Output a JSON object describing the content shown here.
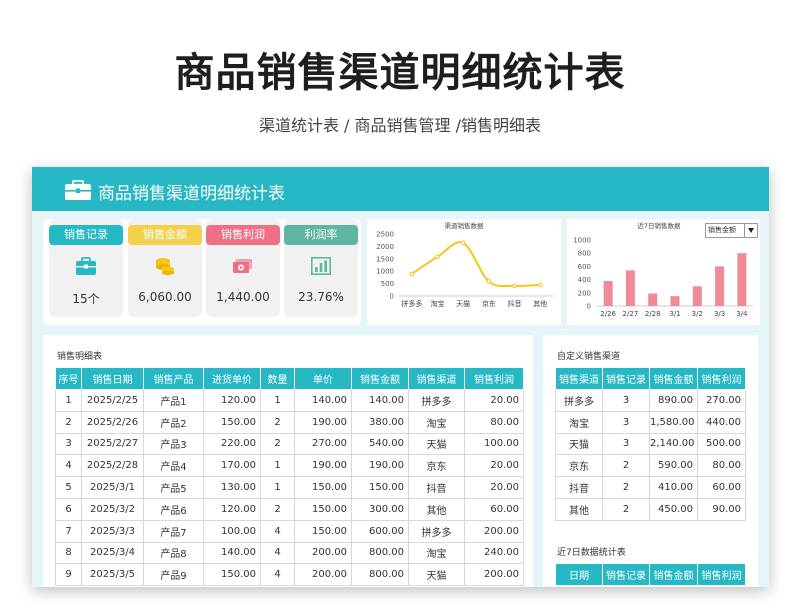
{
  "title": "商品销售渠道明细统计表",
  "subtitle": "渠道统计表 / 商品销售管理 /销售明细表",
  "header": {
    "title": "商品销售渠道明细统计表",
    "icon": "briefcase-icon"
  },
  "stats": [
    {
      "label": "销售记录",
      "value": "15个",
      "color": "#27b8c6",
      "icon": "briefcase-icon"
    },
    {
      "label": "销售金额",
      "value": "6,060.00",
      "color": "#f5d04d",
      "icon": "coins-icon"
    },
    {
      "label": "销售利润",
      "value": "1,440.00",
      "color": "#ef6f86",
      "icon": "money-icon"
    },
    {
      "label": "利润率",
      "value": "23.76%",
      "color": "#5fb6a0",
      "icon": "bar-chart-icon"
    }
  ],
  "chart_data": [
    {
      "type": "line",
      "title": "渠道销售数据",
      "categories": [
        "拼多多",
        "淘宝",
        "天猫",
        "京东",
        "抖音",
        "其他"
      ],
      "values": [
        890,
        1580,
        2140,
        590,
        410,
        450
      ],
      "ylim": [
        0,
        2500
      ],
      "yticks": [
        "0",
        "500",
        "1000",
        "1500",
        "2000",
        "2500"
      ],
      "color": "#f5c518"
    },
    {
      "type": "bar",
      "title": "近7日销售数据",
      "categories": [
        "2/26",
        "2/27",
        "2/28",
        "3/1",
        "3/2",
        "3/3",
        "3/4"
      ],
      "values": [
        380,
        540,
        190,
        150,
        300,
        600,
        800
      ],
      "ylim": [
        0,
        1000
      ],
      "yticks": [
        "0",
        "200",
        "400",
        "600",
        "800",
        "1000"
      ],
      "color": "#f08a97",
      "dropdown_value": "销售金额"
    }
  ],
  "detail_table": {
    "caption": "销售明细表",
    "headers": [
      "序号",
      "销售日期",
      "销售产品",
      "进货单价",
      "数量",
      "单价",
      "销售金额",
      "销售渠道",
      "销售利润"
    ],
    "rows": [
      [
        "1",
        "2025/2/25",
        "产品1",
        "120.00",
        "1",
        "140.00",
        "140.00",
        "拼多多",
        "20.00"
      ],
      [
        "2",
        "2025/2/26",
        "产品2",
        "150.00",
        "2",
        "190.00",
        "380.00",
        "淘宝",
        "80.00"
      ],
      [
        "3",
        "2025/2/27",
        "产品3",
        "220.00",
        "2",
        "270.00",
        "540.00",
        "天猫",
        "100.00"
      ],
      [
        "4",
        "2025/2/28",
        "产品4",
        "170.00",
        "1",
        "190.00",
        "190.00",
        "京东",
        "20.00"
      ],
      [
        "5",
        "2025/3/1",
        "产品5",
        "130.00",
        "1",
        "150.00",
        "150.00",
        "抖音",
        "20.00"
      ],
      [
        "6",
        "2025/3/2",
        "产品6",
        "120.00",
        "2",
        "150.00",
        "300.00",
        "其他",
        "60.00"
      ],
      [
        "7",
        "2025/3/3",
        "产品7",
        "100.00",
        "4",
        "150.00",
        "600.00",
        "拼多多",
        "200.00"
      ],
      [
        "8",
        "2025/3/4",
        "产品8",
        "140.00",
        "4",
        "200.00",
        "800.00",
        "淘宝",
        "240.00"
      ],
      [
        "9",
        "2025/3/5",
        "产品9",
        "150.00",
        "4",
        "200.00",
        "800.00",
        "天猫",
        "200.00"
      ]
    ]
  },
  "channel_table": {
    "caption": "自定义销售渠道",
    "headers": [
      "销售渠道",
      "销售记录",
      "销售金额",
      "销售利润"
    ],
    "rows": [
      [
        "拼多多",
        "3",
        "890.00",
        "270.00"
      ],
      [
        "淘宝",
        "3",
        "1,580.00",
        "440.00"
      ],
      [
        "天猫",
        "3",
        "2,140.00",
        "500.00"
      ],
      [
        "京东",
        "2",
        "590.00",
        "80.00"
      ],
      [
        "抖音",
        "2",
        "410.00",
        "60.00"
      ],
      [
        "其他",
        "2",
        "450.00",
        "90.00"
      ]
    ]
  },
  "week_table": {
    "caption": "近7日数据统计表",
    "headers": [
      "日期",
      "销售记录",
      "销售金额",
      "销售利润"
    ]
  }
}
